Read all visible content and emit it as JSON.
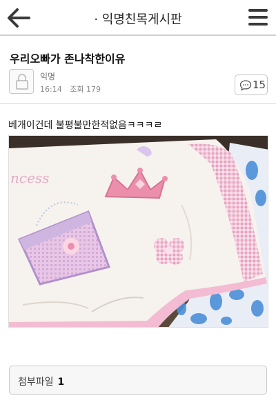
{
  "header": {
    "title": "· 익명친목게시판"
  },
  "post": {
    "title": "우리오빠가 존나착한이유",
    "author": "익명",
    "time": "16:14",
    "views_label": "조회",
    "views": "179",
    "comment_count": "15",
    "body": "베개이건데 불평불만한적없음ㅋㅋㅋㄹ"
  },
  "photo": {
    "text": "ncess"
  },
  "attachments": {
    "label": "첨부파일",
    "count": "1"
  },
  "colors": {
    "divider": "#cfcfcf",
    "pillow_pink": "#e9a7c3",
    "crown_pink": "#e6849e",
    "purse_purple": "#b59fd0",
    "flowers_blue": "#3f86d3"
  },
  "icons": {
    "back": "arrow-left-icon",
    "menu": "hamburger-menu-icon",
    "avatar": "lock-icon",
    "comment": "speech-bubble-icon"
  }
}
